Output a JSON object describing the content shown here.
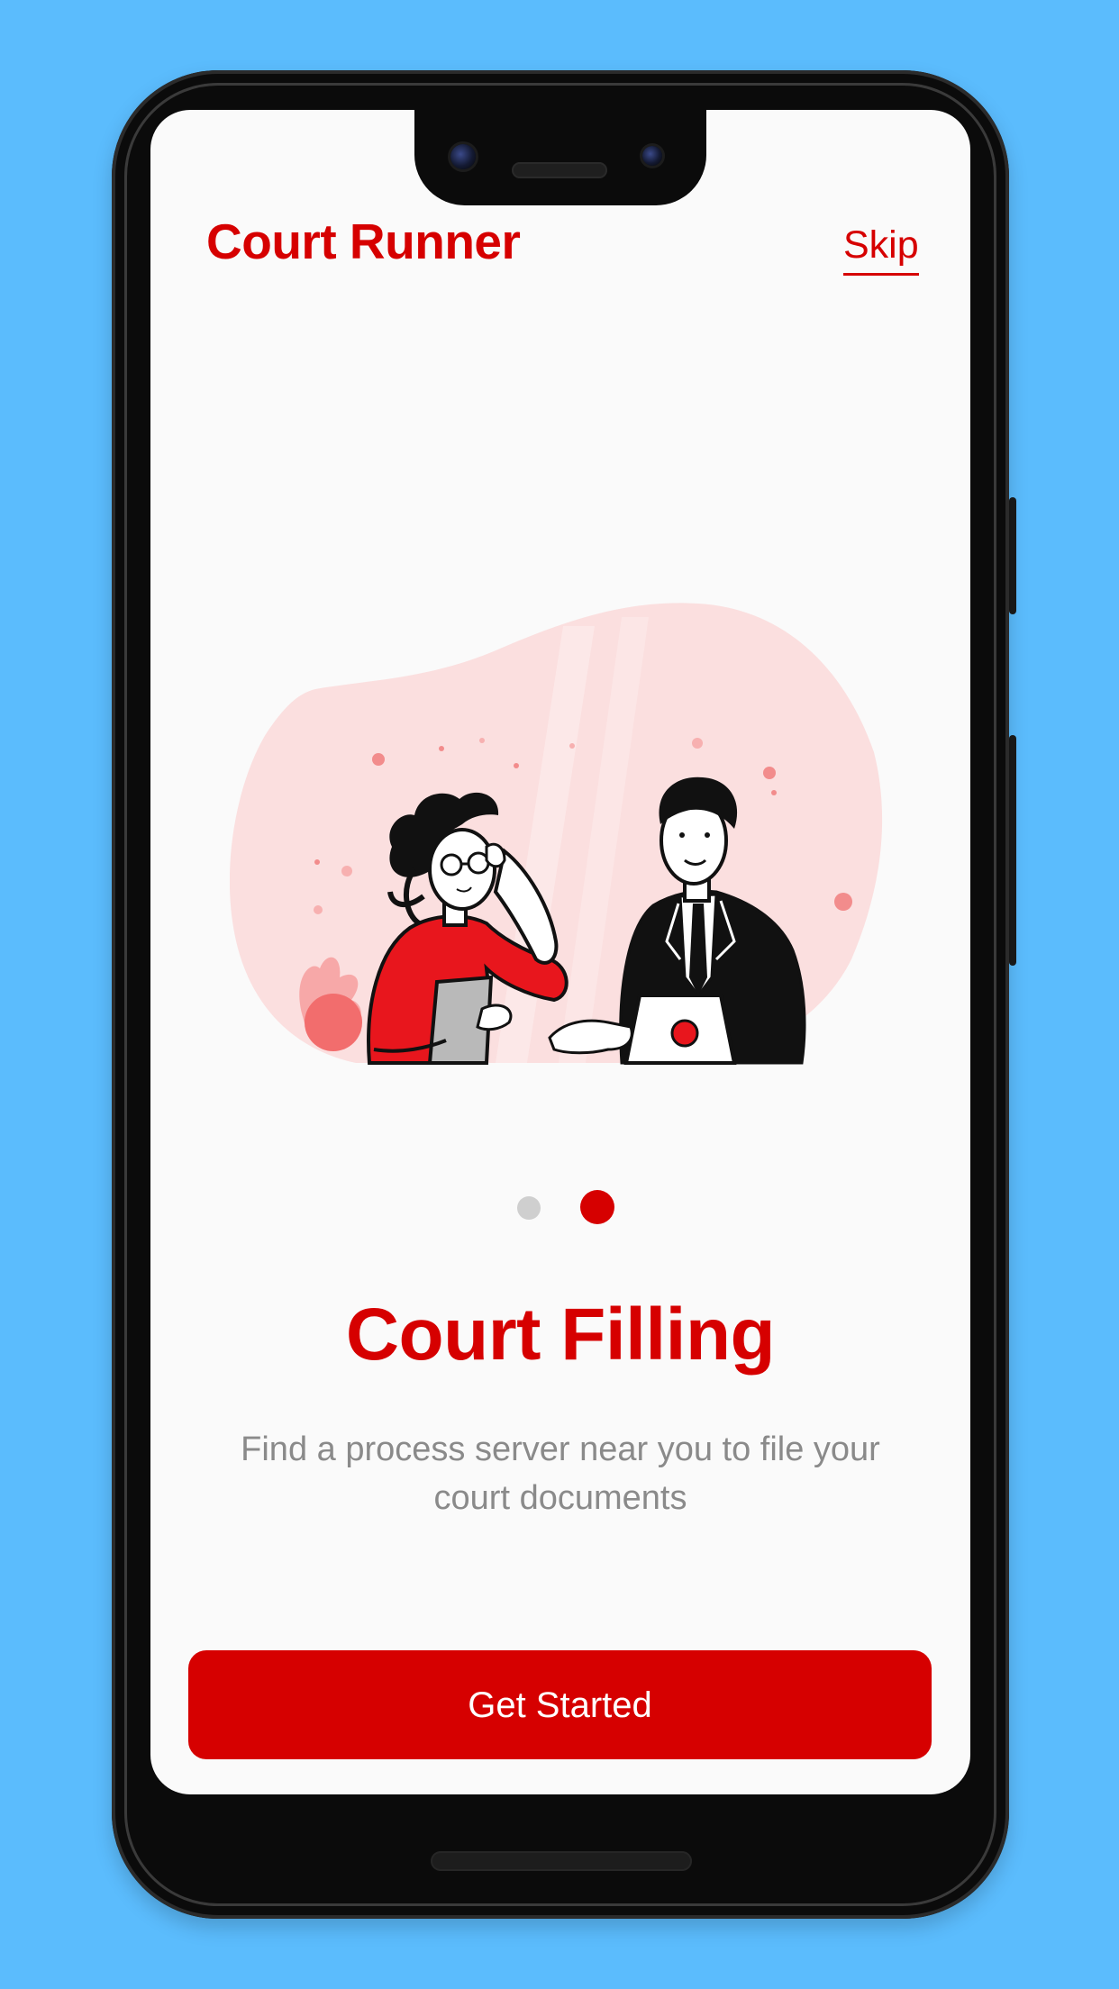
{
  "app": {
    "title": "Court Runner",
    "skip_label": "Skip"
  },
  "onboarding": {
    "slide_title": "Court Filling",
    "slide_description": "Find a process server near you to file your court documents",
    "page_count": 2,
    "active_page": 2,
    "cta_label": "Get Started"
  },
  "colors": {
    "brand_red": "#d60000",
    "background": "#5bbcfd",
    "screen": "#fafafa",
    "blob_pink": "#fbdfdf",
    "inactive_dot": "#cfcfcf",
    "description_gray": "#8a8a8a"
  }
}
